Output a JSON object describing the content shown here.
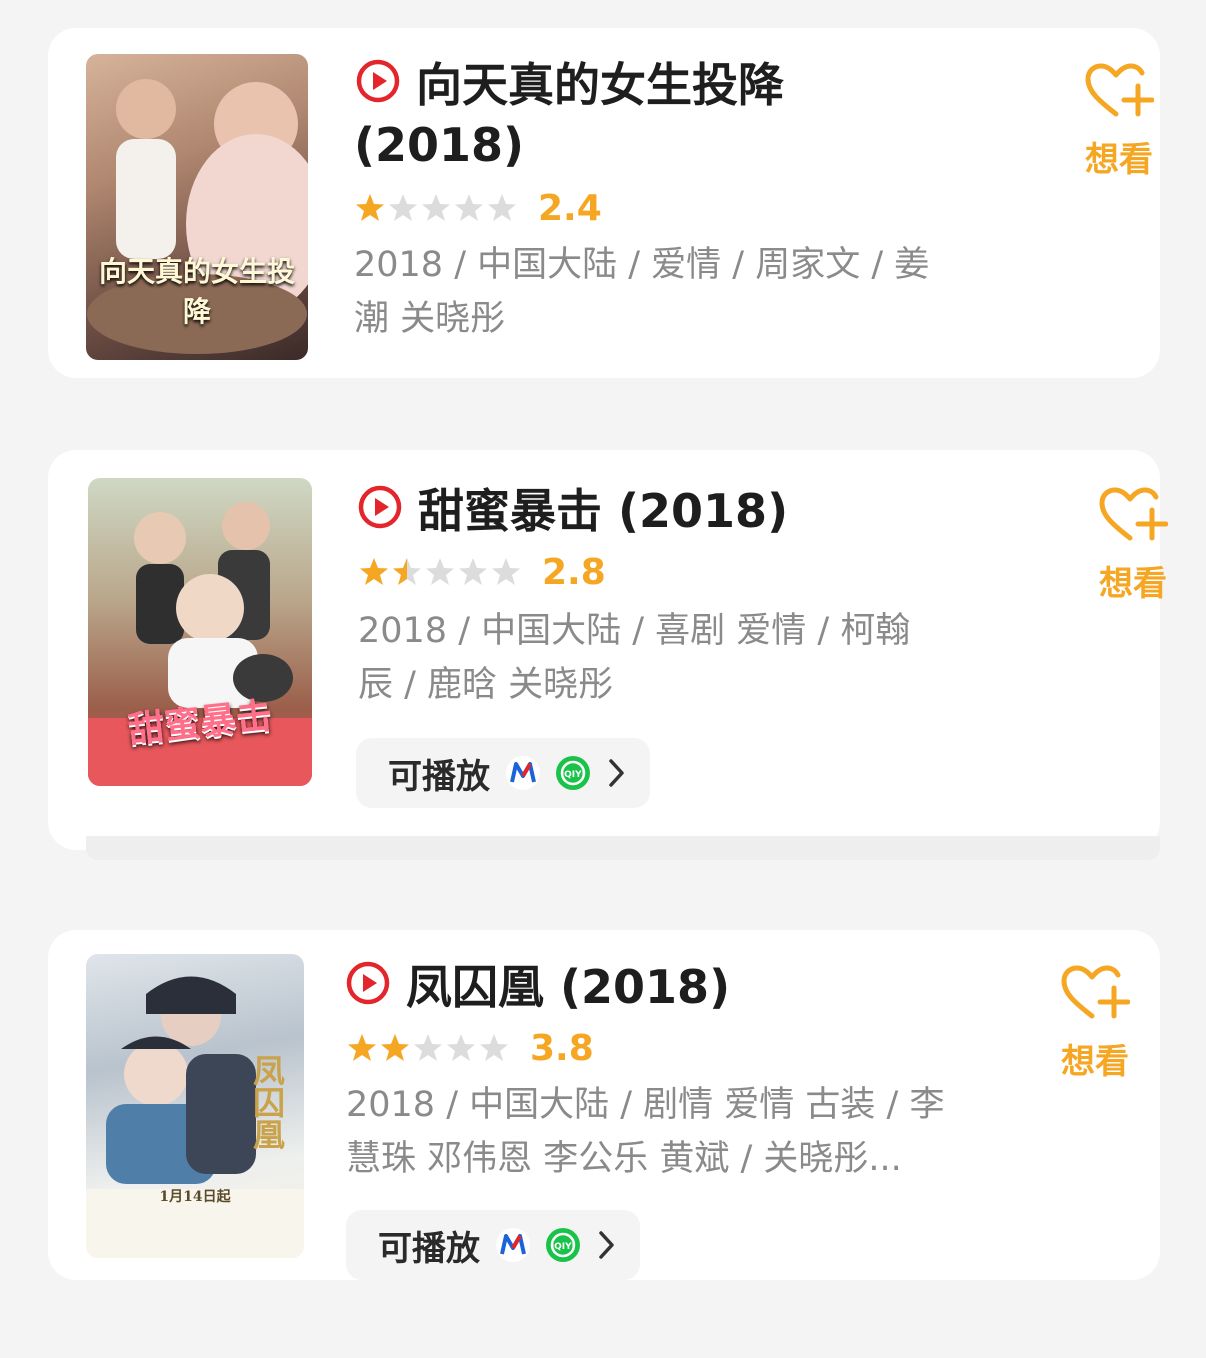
{
  "items": [
    {
      "title_line1": "向天真的女生投降",
      "title_line2": "(2018)",
      "rating": "2.4",
      "stars_full": 1,
      "stars_half": 0,
      "meta_line1": "2018 / 中国大陆 / 爱情 / 周家文 / 姜",
      "meta_line2": "潮 关晓彤",
      "poster_text": "向天真的女生投降",
      "want_label": "想看"
    },
    {
      "title": "甜蜜暴击 (2018)",
      "rating": "2.8",
      "stars_full": 1,
      "stars_half": 1,
      "meta_line1": "2018 / 中国大陆 / 喜剧 爱情 / 柯翰",
      "meta_line2": "辰 / 鹿晗 关晓彤",
      "play_label": "可播放",
      "poster_text": "甜蜜暴击",
      "want_label": "想看"
    },
    {
      "title": "凤囚凰 (2018)",
      "rating": "3.8",
      "stars_full": 2,
      "stars_half": 0,
      "meta_line1": "2018 / 中国大陆 / 剧情 爱情 古装 / 李",
      "meta_line2": "慧珠 邓伟恩 李公乐 黄斌 / 关晓彤...",
      "play_label": "可播放",
      "poster_text": "凤囚凰",
      "poster_date": "1月14日起",
      "want_label": "想看"
    }
  ],
  "colors": {
    "accent": "#f5a623",
    "play_red": "#e3262c",
    "meta_gray": "#8a8a8a"
  },
  "icons": [
    "play-circle-icon",
    "star-icon",
    "heart-plus-icon",
    "mgtv-icon",
    "iqiyi-icon",
    "chevron-right-icon"
  ]
}
